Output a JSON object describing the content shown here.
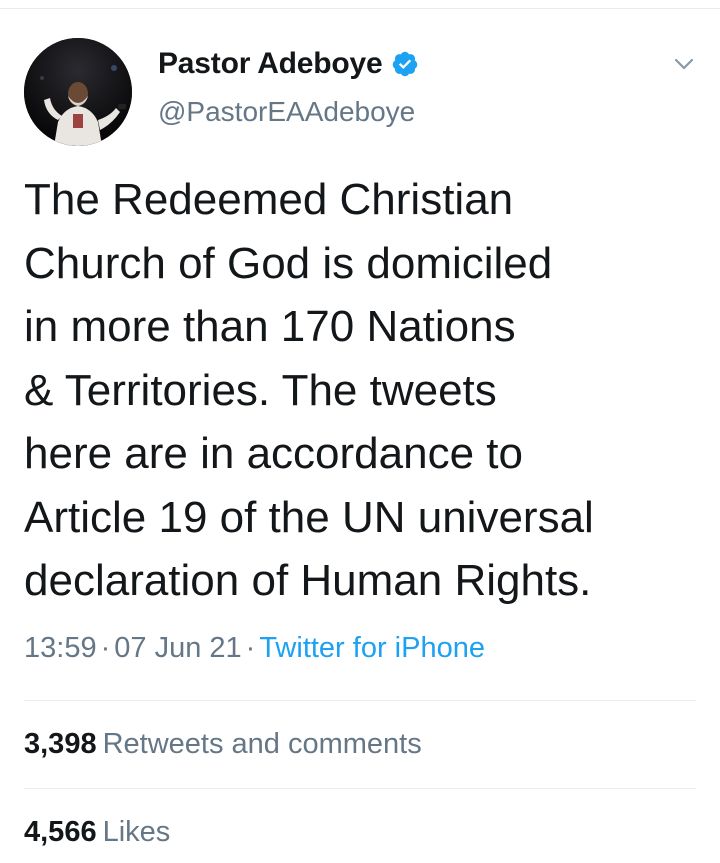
{
  "author": {
    "display_name": "Pastor Adeboye",
    "handle": "@PastorEAAdeboye",
    "verified": true,
    "avatar_icon": "profile-photo",
    "verified_icon": "verified-badge-icon"
  },
  "tweet": {
    "lines": [
      "The Redeemed Christian",
      "Church of God is domiciled",
      "in more than 170 Nations",
      "& Territories. The tweets",
      "here are in accordance to",
      "Article 19 of the UN universal",
      "declaration of Human Rights."
    ],
    "time": "13:59",
    "date": "07 Jun 21",
    "separator": "·",
    "source": "Twitter for iPhone"
  },
  "stats": {
    "retweets_count": "3,398",
    "retweets_label": "Retweets and comments",
    "likes_count": "4,566",
    "likes_label": "Likes"
  },
  "colors": {
    "accent": "#1da1f2",
    "text": "#14171a",
    "secondary": "#657786",
    "divider": "#e6ecf0"
  }
}
